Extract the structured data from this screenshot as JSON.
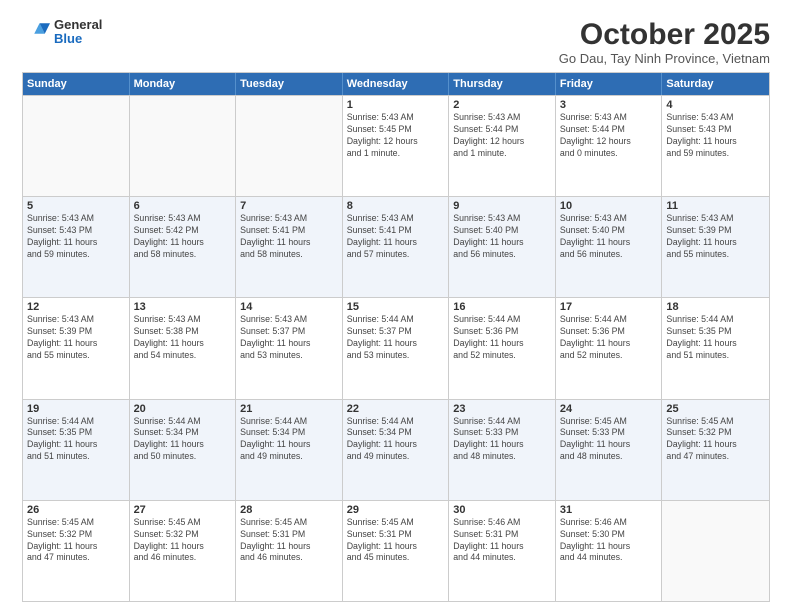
{
  "logo": {
    "general": "General",
    "blue": "Blue"
  },
  "header": {
    "month": "October 2025",
    "location": "Go Dau, Tay Ninh Province, Vietnam"
  },
  "days": [
    "Sunday",
    "Monday",
    "Tuesday",
    "Wednesday",
    "Thursday",
    "Friday",
    "Saturday"
  ],
  "weeks": [
    [
      {
        "date": "",
        "info": ""
      },
      {
        "date": "",
        "info": ""
      },
      {
        "date": "",
        "info": ""
      },
      {
        "date": "1",
        "info": "Sunrise: 5:43 AM\nSunset: 5:45 PM\nDaylight: 12 hours\nand 1 minute."
      },
      {
        "date": "2",
        "info": "Sunrise: 5:43 AM\nSunset: 5:44 PM\nDaylight: 12 hours\nand 1 minute."
      },
      {
        "date": "3",
        "info": "Sunrise: 5:43 AM\nSunset: 5:44 PM\nDaylight: 12 hours\nand 0 minutes."
      },
      {
        "date": "4",
        "info": "Sunrise: 5:43 AM\nSunset: 5:43 PM\nDaylight: 11 hours\nand 59 minutes."
      }
    ],
    [
      {
        "date": "5",
        "info": "Sunrise: 5:43 AM\nSunset: 5:43 PM\nDaylight: 11 hours\nand 59 minutes."
      },
      {
        "date": "6",
        "info": "Sunrise: 5:43 AM\nSunset: 5:42 PM\nDaylight: 11 hours\nand 58 minutes."
      },
      {
        "date": "7",
        "info": "Sunrise: 5:43 AM\nSunset: 5:41 PM\nDaylight: 11 hours\nand 58 minutes."
      },
      {
        "date": "8",
        "info": "Sunrise: 5:43 AM\nSunset: 5:41 PM\nDaylight: 11 hours\nand 57 minutes."
      },
      {
        "date": "9",
        "info": "Sunrise: 5:43 AM\nSunset: 5:40 PM\nDaylight: 11 hours\nand 56 minutes."
      },
      {
        "date": "10",
        "info": "Sunrise: 5:43 AM\nSunset: 5:40 PM\nDaylight: 11 hours\nand 56 minutes."
      },
      {
        "date": "11",
        "info": "Sunrise: 5:43 AM\nSunset: 5:39 PM\nDaylight: 11 hours\nand 55 minutes."
      }
    ],
    [
      {
        "date": "12",
        "info": "Sunrise: 5:43 AM\nSunset: 5:39 PM\nDaylight: 11 hours\nand 55 minutes."
      },
      {
        "date": "13",
        "info": "Sunrise: 5:43 AM\nSunset: 5:38 PM\nDaylight: 11 hours\nand 54 minutes."
      },
      {
        "date": "14",
        "info": "Sunrise: 5:43 AM\nSunset: 5:37 PM\nDaylight: 11 hours\nand 53 minutes."
      },
      {
        "date": "15",
        "info": "Sunrise: 5:44 AM\nSunset: 5:37 PM\nDaylight: 11 hours\nand 53 minutes."
      },
      {
        "date": "16",
        "info": "Sunrise: 5:44 AM\nSunset: 5:36 PM\nDaylight: 11 hours\nand 52 minutes."
      },
      {
        "date": "17",
        "info": "Sunrise: 5:44 AM\nSunset: 5:36 PM\nDaylight: 11 hours\nand 52 minutes."
      },
      {
        "date": "18",
        "info": "Sunrise: 5:44 AM\nSunset: 5:35 PM\nDaylight: 11 hours\nand 51 minutes."
      }
    ],
    [
      {
        "date": "19",
        "info": "Sunrise: 5:44 AM\nSunset: 5:35 PM\nDaylight: 11 hours\nand 51 minutes."
      },
      {
        "date": "20",
        "info": "Sunrise: 5:44 AM\nSunset: 5:34 PM\nDaylight: 11 hours\nand 50 minutes."
      },
      {
        "date": "21",
        "info": "Sunrise: 5:44 AM\nSunset: 5:34 PM\nDaylight: 11 hours\nand 49 minutes."
      },
      {
        "date": "22",
        "info": "Sunrise: 5:44 AM\nSunset: 5:34 PM\nDaylight: 11 hours\nand 49 minutes."
      },
      {
        "date": "23",
        "info": "Sunrise: 5:44 AM\nSunset: 5:33 PM\nDaylight: 11 hours\nand 48 minutes."
      },
      {
        "date": "24",
        "info": "Sunrise: 5:45 AM\nSunset: 5:33 PM\nDaylight: 11 hours\nand 48 minutes."
      },
      {
        "date": "25",
        "info": "Sunrise: 5:45 AM\nSunset: 5:32 PM\nDaylight: 11 hours\nand 47 minutes."
      }
    ],
    [
      {
        "date": "26",
        "info": "Sunrise: 5:45 AM\nSunset: 5:32 PM\nDaylight: 11 hours\nand 47 minutes."
      },
      {
        "date": "27",
        "info": "Sunrise: 5:45 AM\nSunset: 5:32 PM\nDaylight: 11 hours\nand 46 minutes."
      },
      {
        "date": "28",
        "info": "Sunrise: 5:45 AM\nSunset: 5:31 PM\nDaylight: 11 hours\nand 46 minutes."
      },
      {
        "date": "29",
        "info": "Sunrise: 5:45 AM\nSunset: 5:31 PM\nDaylight: 11 hours\nand 45 minutes."
      },
      {
        "date": "30",
        "info": "Sunrise: 5:46 AM\nSunset: 5:31 PM\nDaylight: 11 hours\nand 44 minutes."
      },
      {
        "date": "31",
        "info": "Sunrise: 5:46 AM\nSunset: 5:30 PM\nDaylight: 11 hours\nand 44 minutes."
      },
      {
        "date": "",
        "info": ""
      }
    ]
  ]
}
